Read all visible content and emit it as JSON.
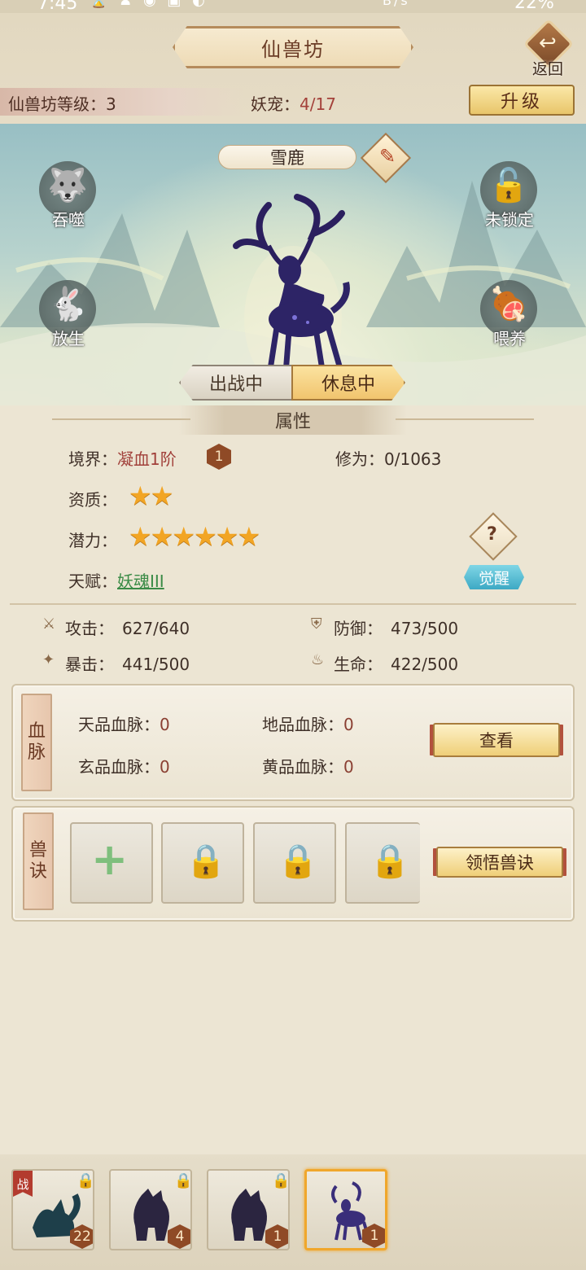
{
  "status_bar": {
    "time": "7:45",
    "network_speed": "B/s",
    "battery": "22%"
  },
  "header": {
    "title": "仙兽坊",
    "back_label": "返回",
    "level_label": "仙兽坊等级：",
    "level_value": "3",
    "pet_label": "妖宠：",
    "pet_count": "4/17",
    "upgrade_label": "升级"
  },
  "scene": {
    "pet_name": "雪鹿",
    "actions": {
      "devour": "吞噬",
      "lock": "未锁定",
      "release": "放生",
      "feed": "喂养"
    },
    "mode_active": "出战中",
    "mode_rest": "休息中"
  },
  "attributes": {
    "header": "属性",
    "realm_label": "境界：",
    "realm_value": "凝血1阶",
    "realm_badge": "1",
    "cultivation_label": "修为：",
    "cultivation_value": "0/1063",
    "aptitude_label": "资质：",
    "aptitude_stars": 2,
    "potential_label": "潜力：",
    "potential_stars": 6,
    "talent_label": "天赋：",
    "talent_value": "妖魂III",
    "awaken_label": "觉醒",
    "help_icon": "?"
  },
  "stats": {
    "attack_label": "攻击：",
    "attack_value": "627/640",
    "defense_label": "防御：",
    "defense_value": "473/500",
    "crit_label": "暴击：",
    "crit_value": "441/500",
    "hp_label": "生命：",
    "hp_value": "422/500"
  },
  "bloodline": {
    "tab_label": "血脉",
    "heaven_label": "天品血脉：",
    "heaven_value": "0",
    "earth_label": "地品血脉：",
    "earth_value": "0",
    "mystic_label": "玄品血脉：",
    "mystic_value": "0",
    "yellow_label": "黄品血脉：",
    "yellow_value": "0",
    "view_label": "查看"
  },
  "skills": {
    "tab_label": "兽诀",
    "learn_label": "领悟兽诀",
    "slots": [
      "add",
      "locked",
      "locked",
      "locked"
    ]
  },
  "pet_list": [
    {
      "level": "22",
      "in_battle": true,
      "battle_tag": "战",
      "selected": false,
      "color": "#1e3f4a"
    },
    {
      "level": "4",
      "in_battle": false,
      "selected": false,
      "color": "#2b2540"
    },
    {
      "level": "1",
      "in_battle": false,
      "selected": false,
      "color": "#2b2540"
    },
    {
      "level": "1",
      "in_battle": false,
      "selected": true,
      "color": "#3a2e7a"
    }
  ],
  "colors": {
    "accent_gold": "#f0a72c",
    "value_red": "#a1403a",
    "talent_green": "#3a8b46",
    "awaken_teal": "#3da9c4"
  }
}
